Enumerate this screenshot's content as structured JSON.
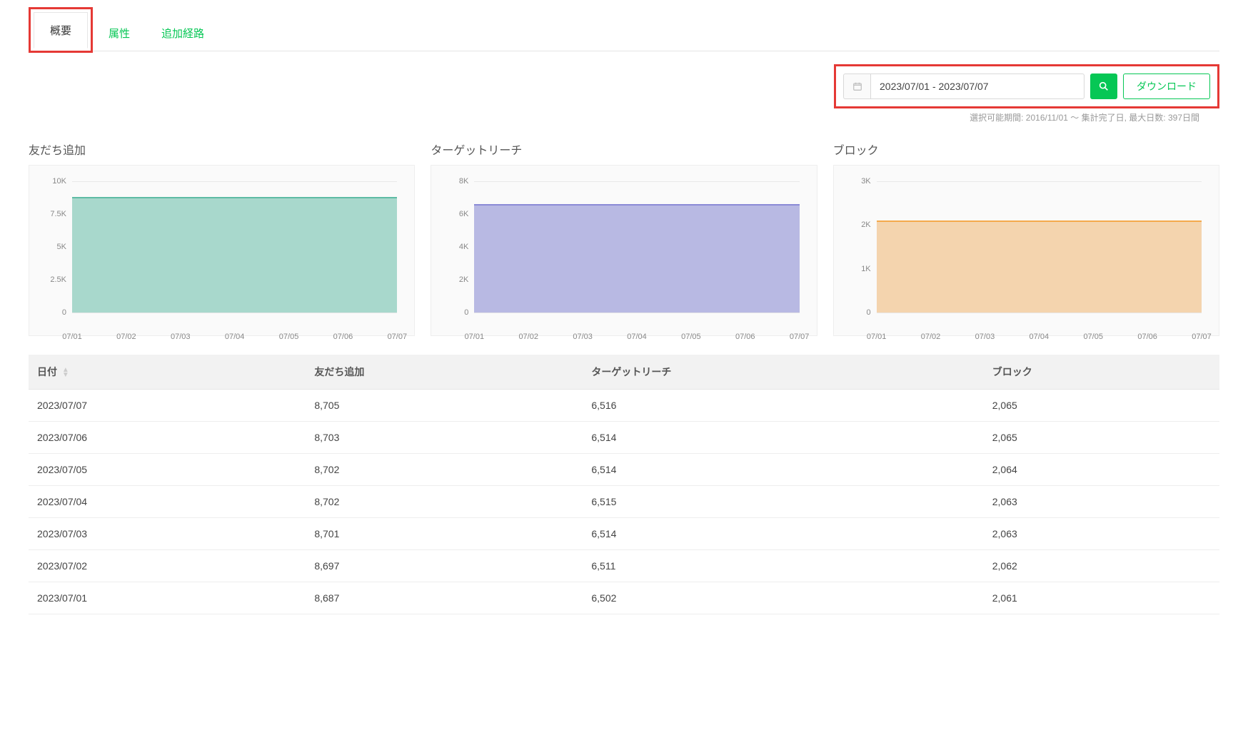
{
  "tabs": [
    {
      "id": "overview",
      "label": "概要",
      "active": true
    },
    {
      "id": "attribute",
      "label": "属性",
      "active": false
    },
    {
      "id": "route",
      "label": "追加経路",
      "active": false
    }
  ],
  "controls": {
    "date_range_value": "2023/07/01 - 2023/07/07",
    "download_label": "ダウンロード",
    "hint_text": "選択可能期間: 2016/11/01 ～ 集計完了日, 最大日数: 397日間"
  },
  "charts_meta": [
    {
      "id": "friends",
      "title": "友だち追加",
      "fill": "#a8d8cc",
      "line": "#5fbca5",
      "y_max": 10000,
      "y_ticks": [
        {
          "v": 0,
          "l": "0"
        },
        {
          "v": 2500,
          "l": "2.5K"
        },
        {
          "v": 5000,
          "l": "5K"
        },
        {
          "v": 7500,
          "l": "7.5K"
        },
        {
          "v": 10000,
          "l": "10K"
        }
      ]
    },
    {
      "id": "reach",
      "title": "ターゲットリーチ",
      "fill": "#b8b9e3",
      "line": "#8a8ad6",
      "y_max": 8000,
      "y_ticks": [
        {
          "v": 0,
          "l": "0"
        },
        {
          "v": 2000,
          "l": "2K"
        },
        {
          "v": 4000,
          "l": "4K"
        },
        {
          "v": 6000,
          "l": "6K"
        },
        {
          "v": 8000,
          "l": "8K"
        }
      ]
    },
    {
      "id": "block",
      "title": "ブロック",
      "fill": "#f4d4ae",
      "line": "#f4a94d",
      "y_max": 3000,
      "y_ticks": [
        {
          "v": 0,
          "l": "0"
        },
        {
          "v": 1000,
          "l": "1K"
        },
        {
          "v": 2000,
          "l": "2K"
        },
        {
          "v": 3000,
          "l": "3K"
        }
      ]
    }
  ],
  "chart_data": [
    {
      "type": "area",
      "title": "友だち追加",
      "ylabel": "",
      "xlabel": "",
      "ylim": [
        0,
        10000
      ],
      "categories": [
        "07/01",
        "07/02",
        "07/03",
        "07/04",
        "07/05",
        "07/06",
        "07/07"
      ],
      "values": [
        8687,
        8697,
        8701,
        8702,
        8702,
        8703,
        8705
      ]
    },
    {
      "type": "area",
      "title": "ターゲットリーチ",
      "ylabel": "",
      "xlabel": "",
      "ylim": [
        0,
        8000
      ],
      "categories": [
        "07/01",
        "07/02",
        "07/03",
        "07/04",
        "07/05",
        "07/06",
        "07/07"
      ],
      "values": [
        6502,
        6511,
        6514,
        6515,
        6514,
        6514,
        6516
      ]
    },
    {
      "type": "area",
      "title": "ブロック",
      "ylabel": "",
      "xlabel": "",
      "ylim": [
        0,
        3000
      ],
      "categories": [
        "07/01",
        "07/02",
        "07/03",
        "07/04",
        "07/05",
        "07/06",
        "07/07"
      ],
      "values": [
        2061,
        2062,
        2063,
        2063,
        2064,
        2065,
        2065
      ]
    }
  ],
  "table": {
    "headers": [
      "日付",
      "友だち追加",
      "ターゲットリーチ",
      "ブロック"
    ],
    "rows": [
      {
        "date": "2023/07/07",
        "friends": "8,705",
        "reach": "6,516",
        "block": "2,065"
      },
      {
        "date": "2023/07/06",
        "friends": "8,703",
        "reach": "6,514",
        "block": "2,065"
      },
      {
        "date": "2023/07/05",
        "friends": "8,702",
        "reach": "6,514",
        "block": "2,064"
      },
      {
        "date": "2023/07/04",
        "friends": "8,702",
        "reach": "6,515",
        "block": "2,063"
      },
      {
        "date": "2023/07/03",
        "friends": "8,701",
        "reach": "6,514",
        "block": "2,063"
      },
      {
        "date": "2023/07/02",
        "friends": "8,697",
        "reach": "6,511",
        "block": "2,062"
      },
      {
        "date": "2023/07/01",
        "friends": "8,687",
        "reach": "6,502",
        "block": "2,061"
      }
    ]
  }
}
